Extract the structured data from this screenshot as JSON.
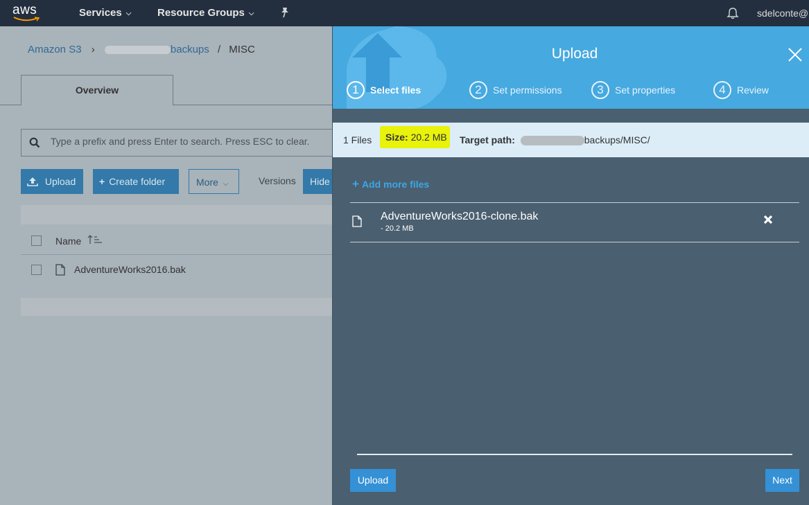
{
  "topnav": {
    "logo_text": "aws",
    "services": "Services",
    "resource_groups": "Resource Groups",
    "user": "sdelconte@"
  },
  "breadcrumb": {
    "root": "Amazon S3",
    "separator": "›",
    "bucket_suffix": "backups",
    "slash": "/",
    "current": "MISC"
  },
  "console": {
    "tab_overview": "Overview",
    "search_placeholder": "Type a prefix and press Enter to search. Press ESC to clear.",
    "btn_upload": "Upload",
    "btn_create_folder": "Create folder",
    "btn_more": "More",
    "versions_label": "Versions",
    "btn_hide": "Hide",
    "col_name": "Name",
    "files": [
      {
        "name": "AdventureWorks2016.bak"
      }
    ]
  },
  "modal": {
    "title": "Upload",
    "steps": [
      {
        "num": "1",
        "label": "Select files"
      },
      {
        "num": "2",
        "label": "Set permissions"
      },
      {
        "num": "3",
        "label": "Set properties"
      },
      {
        "num": "4",
        "label": "Review"
      }
    ],
    "info": {
      "files_count": "1 Files",
      "size_label": "Size:",
      "size_value": "20.2 MB",
      "target_label": "Target path:",
      "target_suffix": "backups/MISC/"
    },
    "add_more": "Add more files",
    "file": {
      "name": "AdventureWorks2016-clone.bak",
      "size": "- 20.2 MB"
    },
    "btn_upload": "Upload",
    "btn_next": "Next"
  },
  "colors": {
    "nav_bg": "#232f3e",
    "modal_header": "#46a9e0",
    "modal_body": "#4a5f6f",
    "highlight": "#e8f20a",
    "accent": "#3491d6"
  }
}
